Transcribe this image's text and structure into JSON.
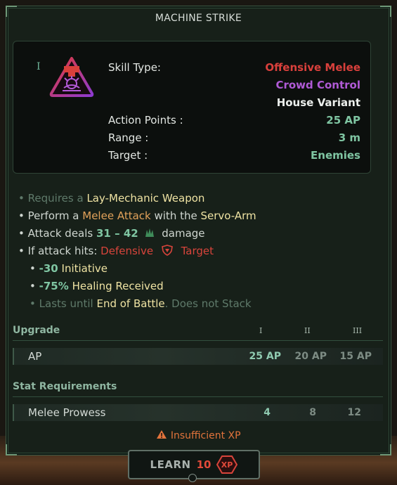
{
  "title": "MACHINE STRIKE",
  "header": {
    "tier_badge": "I",
    "icon": "melee-hand-icon",
    "rows": [
      {
        "label": "Skill Type:",
        "value": "Offensive Melee",
        "color": "#d9403c"
      },
      {
        "label": "",
        "value": "Crowd Control",
        "color": "#b05ad6"
      },
      {
        "label": "",
        "value": "House Variant",
        "color": "#ecefec"
      },
      {
        "label": "Action Points :",
        "value": "25 AP",
        "color": "#7fc5a2"
      },
      {
        "label": "Range :",
        "value": "3 m",
        "color": "#7fc5a2"
      },
      {
        "label": "Target :",
        "value": "Enemies",
        "color": "#7fc5a2"
      }
    ]
  },
  "description": {
    "l1": {
      "bullet": "•",
      "pre": "Requires a",
      "hl": "Lay-Mechanic Weapon"
    },
    "l2": {
      "bullet": "•",
      "pre": "Perform a",
      "hl1": "Melee Attack",
      "mid": "with the",
      "hl2": "Servo-Arm"
    },
    "l3": {
      "bullet": "•",
      "pre": "Attack deals",
      "dmg": "31 – 42",
      "post": "damage",
      "icon": "damage-claw-icon"
    },
    "l4": {
      "bullet": "•",
      "pre": "If attack hits:",
      "hl1": "Defensive",
      "hl2": "Target",
      "icon": "shield-icon"
    },
    "l5": {
      "bullet": "•",
      "num": "-30",
      "txt": "Initiative"
    },
    "l6": {
      "bullet": "•",
      "num": "-75%",
      "txt": "Healing Received"
    },
    "l7": {
      "bullet": "•",
      "pre": "Lasts until",
      "hl": "End of Battle",
      "post": ". Does not Stack"
    }
  },
  "upgrade": {
    "heading": "Upgrade",
    "tiers": [
      "I",
      "II",
      "III"
    ],
    "row": {
      "name": "AP",
      "values": [
        "25 AP",
        "20 AP",
        "15 AP"
      ]
    }
  },
  "requirements": {
    "heading": "Stat Requirements",
    "row": {
      "name": "Melee Prowess",
      "values": [
        "4",
        "8",
        "12"
      ]
    }
  },
  "warning": {
    "icon": "warning-icon",
    "text": "Insufficient XP"
  },
  "learn": {
    "label": "LEARN",
    "cost": "10",
    "icon": "xp-icon",
    "icon_text": "XP"
  }
}
